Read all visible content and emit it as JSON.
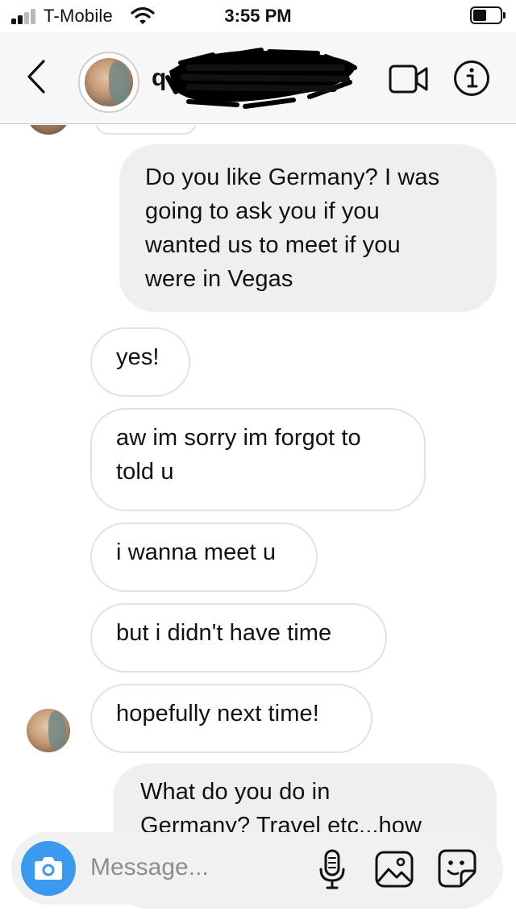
{
  "status_bar": {
    "carrier": "T-Mobile",
    "time": "3:55 PM",
    "signal_bars_filled": 2,
    "signal_bars_total": 4,
    "battery_level": 0.45
  },
  "header": {
    "username_visible": "q",
    "icons": {
      "back": "chevron-left-icon",
      "video": "video-camera-icon",
      "info": "info-icon"
    }
  },
  "messages": [
    {
      "direction": "outgoing",
      "lines": [
        "Do you like Germany? I was",
        "going to ask you if you",
        "wanted us to meet if you",
        "were in Vegas"
      ]
    },
    {
      "direction": "incoming",
      "lines": [
        "yes!"
      ]
    },
    {
      "direction": "incoming",
      "lines": [
        "aw im sorry im forgot to",
        "told u"
      ]
    },
    {
      "direction": "incoming",
      "lines": [
        "i wanna meet u"
      ]
    },
    {
      "direction": "incoming",
      "lines": [
        "but i didn't have time"
      ]
    },
    {
      "direction": "incoming",
      "lines": [
        "hopefully next time!"
      ]
    },
    {
      "direction": "outgoing",
      "lines": [
        "What do you do in",
        "Germany? Travel etc...how"
      ]
    }
  ],
  "composer": {
    "placeholder": "Message...",
    "icons": {
      "camera": "camera-icon",
      "mic": "microphone-icon",
      "gallery": "gallery-icon",
      "sticker": "sticker-icon"
    }
  },
  "colors": {
    "accent": "#3b9af0",
    "outgoing_bubble": "#efefef",
    "incoming_border": "#e2e2e2",
    "header_bg": "#f7f7f7"
  }
}
